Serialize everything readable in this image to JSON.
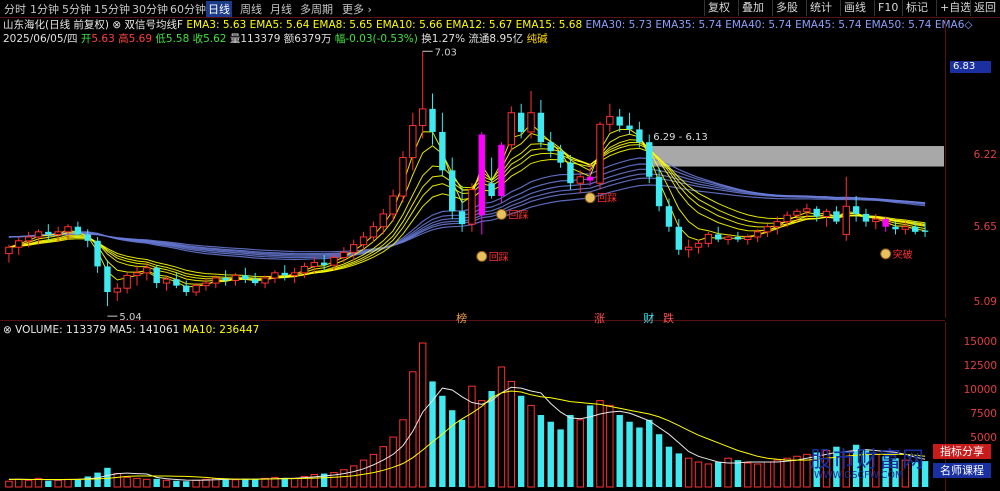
{
  "toolbar": {
    "timeframes": [
      "分时",
      "1分钟",
      "5分钟",
      "15分钟",
      "30分钟",
      "60分钟",
      "日线",
      "周线",
      "月线",
      "多周期",
      "更多"
    ],
    "active_timeframe": "日线",
    "right_buttons": [
      "复权",
      "叠加",
      "多股",
      "统计",
      "画线",
      "F10",
      "标记",
      "+自选",
      "返回"
    ]
  },
  "stock": {
    "name": "山东海化(日线 前复权)",
    "indicator": "双信号均线F"
  },
  "ema_values": {
    "EMA3": "5.63",
    "EMA5": "5.64",
    "EMA8": "5.65",
    "EMA10": "5.66",
    "EMA12": "5.67",
    "EMA15": "5.68",
    "EMA30": "5.73",
    "EMA35": "5.74",
    "EMA40": "5.74",
    "EMA45": "5.74",
    "EMA50": "5.74",
    "EMA6_truncated": "EMA6◇"
  },
  "quote": {
    "date": "2025/06/05/四",
    "open_label": "开",
    "open": "5.63",
    "high_label": "高",
    "high": "5.69",
    "low_label": "低",
    "low": "5.58",
    "close_label": "收",
    "close": "5.62",
    "volume_label": "量",
    "volume": "113379",
    "amount_label": "额",
    "amount": "6379万",
    "change_label": "幅",
    "change": "-0.03(-0.53%)",
    "turnover_label": "换",
    "turnover": "1.27%",
    "float_label": "流通",
    "float_cap": "8.95亿",
    "tag": "纯碱"
  },
  "volume_info": {
    "volume_label": "VOLUME:",
    "volume": "113379",
    "ma5_label": "MA5:",
    "ma5": "141061",
    "ma10_label": "MA10:",
    "ma10": "236447"
  },
  "price_axis": {
    "ticks": [
      "6.22",
      "5.65",
      "5.09"
    ],
    "current": "6.83"
  },
  "volume_axis": {
    "ticks": [
      "15000",
      "12500",
      "10000",
      "7500",
      "5000"
    ]
  },
  "annotations": {
    "high_mark": "7.03",
    "low_mark": "5.04",
    "zone_label": "6.29 - 6.13",
    "signal_1": "回踩",
    "signal_2": "回踩",
    "signal_3": "回踩",
    "signal_4": "突破",
    "event_bang": "榜",
    "event_zhang": "涨",
    "event_cai": "财",
    "event_die": "跌"
  },
  "watermark": {
    "main": "股市财富网",
    "url": "WWW.GSCFW.COM",
    "box1": "指标分享",
    "box2": "名师课程"
  },
  "colors": {
    "up": "#ff3030",
    "down": "#40e8f0",
    "magenta": "#ff00ff",
    "ema_yellow": "#ffff00",
    "ema_blue": "#6a7bd8",
    "zone": "#a8a8a8",
    "accent_blue": "#1a2fa0"
  },
  "chart_data": {
    "type": "candlestick",
    "price_range": [
      5.0,
      6.9
    ],
    "volume_range": [
      0,
      16000
    ],
    "price_ticks": [
      6.22,
      5.65,
      5.09
    ],
    "volume_ticks": [
      15000,
      12500,
      10000,
      7500,
      5000
    ],
    "zone": [
      6.13,
      6.29
    ],
    "candles": [
      {
        "o": 5.45,
        "h": 5.52,
        "l": 5.38,
        "c": 5.5
      },
      {
        "o": 5.5,
        "h": 5.58,
        "l": 5.44,
        "c": 5.55
      },
      {
        "o": 5.55,
        "h": 5.62,
        "l": 5.5,
        "c": 5.58
      },
      {
        "o": 5.58,
        "h": 5.64,
        "l": 5.52,
        "c": 5.62
      },
      {
        "o": 5.62,
        "h": 5.68,
        "l": 5.55,
        "c": 5.6
      },
      {
        "o": 5.6,
        "h": 5.66,
        "l": 5.54,
        "c": 5.62
      },
      {
        "o": 5.62,
        "h": 5.68,
        "l": 5.56,
        "c": 5.66
      },
      {
        "o": 5.66,
        "h": 5.7,
        "l": 5.58,
        "c": 5.6
      },
      {
        "o": 5.6,
        "h": 5.64,
        "l": 5.5,
        "c": 5.55
      },
      {
        "o": 5.55,
        "h": 5.58,
        "l": 5.3,
        "c": 5.35
      },
      {
        "o": 5.35,
        "h": 5.4,
        "l": 5.04,
        "c": 5.15
      },
      {
        "o": 5.15,
        "h": 5.22,
        "l": 5.08,
        "c": 5.18
      },
      {
        "o": 5.18,
        "h": 5.3,
        "l": 5.14,
        "c": 5.28
      },
      {
        "o": 5.28,
        "h": 5.36,
        "l": 5.2,
        "c": 5.3
      },
      {
        "o": 5.3,
        "h": 5.38,
        "l": 5.24,
        "c": 5.34
      },
      {
        "o": 5.34,
        "h": 5.36,
        "l": 5.18,
        "c": 5.22
      },
      {
        "o": 5.22,
        "h": 5.28,
        "l": 5.16,
        "c": 5.25
      },
      {
        "o": 5.25,
        "h": 5.3,
        "l": 5.18,
        "c": 5.2
      },
      {
        "o": 5.2,
        "h": 5.24,
        "l": 5.12,
        "c": 5.15
      },
      {
        "o": 5.15,
        "h": 5.22,
        "l": 5.12,
        "c": 5.2
      },
      {
        "o": 5.2,
        "h": 5.26,
        "l": 5.16,
        "c": 5.22
      },
      {
        "o": 5.22,
        "h": 5.28,
        "l": 5.18,
        "c": 5.26
      },
      {
        "o": 5.26,
        "h": 5.32,
        "l": 5.2,
        "c": 5.24
      },
      {
        "o": 5.24,
        "h": 5.3,
        "l": 5.2,
        "c": 5.28
      },
      {
        "o": 5.28,
        "h": 5.34,
        "l": 5.22,
        "c": 5.25
      },
      {
        "o": 5.25,
        "h": 5.3,
        "l": 5.2,
        "c": 5.22
      },
      {
        "o": 5.22,
        "h": 5.28,
        "l": 5.18,
        "c": 5.26
      },
      {
        "o": 5.26,
        "h": 5.32,
        "l": 5.22,
        "c": 5.3
      },
      {
        "o": 5.3,
        "h": 5.36,
        "l": 5.24,
        "c": 5.28
      },
      {
        "o": 5.28,
        "h": 5.34,
        "l": 5.22,
        "c": 5.3
      },
      {
        "o": 5.3,
        "h": 5.38,
        "l": 5.26,
        "c": 5.35
      },
      {
        "o": 5.35,
        "h": 5.42,
        "l": 5.3,
        "c": 5.38
      },
      {
        "o": 5.38,
        "h": 5.44,
        "l": 5.32,
        "c": 5.36
      },
      {
        "o": 5.36,
        "h": 5.45,
        "l": 5.32,
        "c": 5.42
      },
      {
        "o": 5.42,
        "h": 5.5,
        "l": 5.38,
        "c": 5.46
      },
      {
        "o": 5.46,
        "h": 5.56,
        "l": 5.4,
        "c": 5.52
      },
      {
        "o": 5.52,
        "h": 5.62,
        "l": 5.48,
        "c": 5.58
      },
      {
        "o": 5.58,
        "h": 5.7,
        "l": 5.54,
        "c": 5.66
      },
      {
        "o": 5.66,
        "h": 5.8,
        "l": 5.6,
        "c": 5.76
      },
      {
        "o": 5.76,
        "h": 5.95,
        "l": 5.7,
        "c": 5.9
      },
      {
        "o": 5.9,
        "h": 6.25,
        "l": 5.85,
        "c": 6.2
      },
      {
        "o": 6.2,
        "h": 6.55,
        "l": 6.1,
        "c": 6.45
      },
      {
        "o": 6.45,
        "h": 7.03,
        "l": 6.35,
        "c": 6.58
      },
      {
        "o": 6.58,
        "h": 6.7,
        "l": 6.3,
        "c": 6.4
      },
      {
        "o": 6.4,
        "h": 6.55,
        "l": 6.05,
        "c": 6.1
      },
      {
        "o": 6.1,
        "h": 6.2,
        "l": 5.72,
        "c": 5.78
      },
      {
        "o": 5.78,
        "h": 5.98,
        "l": 5.62,
        "c": 5.68
      },
      {
        "o": 5.68,
        "h": 6.0,
        "l": 5.62,
        "c": 5.95
      },
      {
        "o": 5.75,
        "h": 6.4,
        "l": 5.6,
        "c": 6.38
      },
      {
        "o": 6.0,
        "h": 6.2,
        "l": 5.88,
        "c": 5.9
      },
      {
        "o": 5.9,
        "h": 6.32,
        "l": 5.85,
        "c": 6.3
      },
      {
        "o": 6.3,
        "h": 6.6,
        "l": 6.25,
        "c": 6.55
      },
      {
        "o": 6.55,
        "h": 6.62,
        "l": 6.35,
        "c": 6.4
      },
      {
        "o": 6.4,
        "h": 6.72,
        "l": 6.35,
        "c": 6.55
      },
      {
        "o": 6.55,
        "h": 6.65,
        "l": 6.28,
        "c": 6.32
      },
      {
        "o": 6.32,
        "h": 6.4,
        "l": 6.2,
        "c": 6.25
      },
      {
        "o": 6.25,
        "h": 6.3,
        "l": 6.12,
        "c": 6.16
      },
      {
        "o": 6.16,
        "h": 6.22,
        "l": 5.95,
        "c": 6.0
      },
      {
        "o": 6.0,
        "h": 6.1,
        "l": 5.92,
        "c": 6.05
      },
      {
        "o": 6.05,
        "h": 6.15,
        "l": 5.98,
        "c": 6.02
      },
      {
        "o": 6.0,
        "h": 6.48,
        "l": 5.95,
        "c": 6.46
      },
      {
        "o": 6.46,
        "h": 6.62,
        "l": 6.4,
        "c": 6.52
      },
      {
        "o": 6.52,
        "h": 6.58,
        "l": 6.4,
        "c": 6.45
      },
      {
        "o": 6.45,
        "h": 6.55,
        "l": 6.38,
        "c": 6.42
      },
      {
        "o": 6.42,
        "h": 6.48,
        "l": 6.28,
        "c": 6.32
      },
      {
        "o": 6.32,
        "h": 6.38,
        "l": 6.0,
        "c": 6.05
      },
      {
        "o": 6.05,
        "h": 6.12,
        "l": 5.78,
        "c": 5.82
      },
      {
        "o": 5.82,
        "h": 5.88,
        "l": 5.62,
        "c": 5.66
      },
      {
        "o": 5.66,
        "h": 5.72,
        "l": 5.44,
        "c": 5.48
      },
      {
        "o": 5.48,
        "h": 5.56,
        "l": 5.42,
        "c": 5.5
      },
      {
        "o": 5.5,
        "h": 5.56,
        "l": 5.45,
        "c": 5.53
      },
      {
        "o": 5.53,
        "h": 5.62,
        "l": 5.5,
        "c": 5.6
      },
      {
        "o": 5.6,
        "h": 5.66,
        "l": 5.54,
        "c": 5.56
      },
      {
        "o": 5.56,
        "h": 5.6,
        "l": 5.52,
        "c": 5.58
      },
      {
        "o": 5.58,
        "h": 5.62,
        "l": 5.54,
        "c": 5.56
      },
      {
        "o": 5.56,
        "h": 5.6,
        "l": 5.52,
        "c": 5.58
      },
      {
        "o": 5.58,
        "h": 5.64,
        "l": 5.54,
        "c": 5.62
      },
      {
        "o": 5.62,
        "h": 5.68,
        "l": 5.58,
        "c": 5.66
      },
      {
        "o": 5.66,
        "h": 5.74,
        "l": 5.6,
        "c": 5.7
      },
      {
        "o": 5.7,
        "h": 5.78,
        "l": 5.66,
        "c": 5.75
      },
      {
        "o": 5.75,
        "h": 5.8,
        "l": 5.7,
        "c": 5.78
      },
      {
        "o": 5.78,
        "h": 5.84,
        "l": 5.72,
        "c": 5.8
      },
      {
        "o": 5.8,
        "h": 5.82,
        "l": 5.7,
        "c": 5.74
      },
      {
        "o": 5.74,
        "h": 5.8,
        "l": 5.66,
        "c": 5.78
      },
      {
        "o": 5.78,
        "h": 5.82,
        "l": 5.68,
        "c": 5.7
      },
      {
        "o": 5.6,
        "h": 6.05,
        "l": 5.55,
        "c": 5.82
      },
      {
        "o": 5.82,
        "h": 5.9,
        "l": 5.7,
        "c": 5.76
      },
      {
        "o": 5.76,
        "h": 5.8,
        "l": 5.66,
        "c": 5.7
      },
      {
        "o": 5.7,
        "h": 5.76,
        "l": 5.64,
        "c": 5.72
      },
      {
        "o": 5.72,
        "h": 5.74,
        "l": 5.62,
        "c": 5.66
      },
      {
        "o": 5.66,
        "h": 5.7,
        "l": 5.6,
        "c": 5.64
      },
      {
        "o": 5.64,
        "h": 5.7,
        "l": 5.6,
        "c": 5.66
      },
      {
        "o": 5.66,
        "h": 5.7,
        "l": 5.6,
        "c": 5.62
      },
      {
        "o": 5.63,
        "h": 5.69,
        "l": 5.58,
        "c": 5.62
      }
    ],
    "volumes": [
      600,
      800,
      700,
      900,
      650,
      700,
      800,
      750,
      1100,
      1500,
      2000,
      1400,
      1000,
      900,
      800,
      850,
      700,
      650,
      600,
      700,
      800,
      900,
      800,
      750,
      850,
      800,
      900,
      1000,
      950,
      900,
      1100,
      1300,
      1400,
      1500,
      1800,
      2200,
      2800,
      3400,
      4200,
      5200,
      7000,
      12000,
      15000,
      11000,
      9500,
      8000,
      7000,
      10500,
      9000,
      10000,
      12500,
      11000,
      9500,
      8500,
      7500,
      6800,
      6000,
      7500,
      7000,
      8500,
      9000,
      8500,
      7500,
      6800,
      6200,
      7000,
      5500,
      4200,
      3500,
      3000,
      2600,
      2400,
      2600,
      3000,
      2800,
      2500,
      2400,
      2600,
      2800,
      3000,
      3200,
      3400,
      3600,
      3800,
      4200,
      3600,
      4400,
      3800,
      3400,
      3200,
      3000,
      2800,
      2600,
      2700,
      2500
    ],
    "ma5": [
      800,
      800,
      780,
      780,
      770,
      760,
      780,
      800,
      850,
      950,
      1200,
      1400,
      1450,
      1400,
      1350,
      1000,
      850,
      780,
      720,
      700,
      720,
      760,
      790,
      800,
      820,
      820,
      840,
      860,
      900,
      920,
      980,
      1050,
      1150,
      1250,
      1400,
      1600,
      1900,
      2300,
      2800,
      3400,
      4300,
      5800,
      7800,
      9000,
      10300,
      10100,
      9400,
      8800,
      8600,
      9000,
      9800,
      10400,
      10300,
      10000,
      9800,
      8700,
      7800,
      7200,
      7100,
      7300,
      7600,
      7800,
      7900,
      7700,
      7300,
      6900,
      6200,
      5500,
      4600,
      3700,
      3200,
      2900,
      2600,
      2500,
      2500,
      2600,
      2600,
      2600,
      2600,
      2700,
      2800,
      3000,
      3200,
      3400,
      3600,
      3700,
      3800,
      3900,
      3800,
      3700,
      3600,
      3400,
      3100,
      2900,
      2800
    ],
    "ma10": [
      780,
      790,
      790,
      780,
      780,
      780,
      780,
      790,
      810,
      840,
      900,
      1000,
      1100,
      1150,
      1150,
      1150,
      1150,
      1130,
      1100,
      1050,
      1000,
      900,
      850,
      820,
      800,
      810,
      820,
      840,
      860,
      880,
      900,
      930,
      960,
      1010,
      1080,
      1180,
      1320,
      1500,
      1740,
      2050,
      2450,
      3050,
      3850,
      4700,
      5500,
      6400,
      7100,
      7700,
      8400,
      9300,
      9800,
      10000,
      9900,
      9600,
      9400,
      9300,
      9100,
      8900,
      8800,
      8700,
      8600,
      8400,
      8200,
      8000,
      7800,
      7600,
      7300,
      6900,
      6400,
      5900,
      5400,
      5000,
      4600,
      4200,
      3800,
      3500,
      3200,
      3000,
      2900,
      2800,
      2800,
      2800,
      2900,
      3000,
      3100,
      3200,
      3300,
      3400,
      3400,
      3400,
      3400,
      3400,
      3300,
      3200,
      3100
    ],
    "signals": [
      {
        "index": 48,
        "text_key": "signal_1"
      },
      {
        "index": 50,
        "text_key": "signal_2"
      },
      {
        "index": 59,
        "text_key": "signal_3"
      },
      {
        "index": 89,
        "text_key": "signal_4"
      }
    ],
    "magenta_candles": [
      48,
      50,
      59,
      89
    ],
    "events": [
      {
        "index": 46,
        "key": "event_bang"
      },
      {
        "index": 60,
        "key": "event_zhang"
      },
      {
        "index": 65,
        "key": "event_cai"
      },
      {
        "index": 67,
        "key": "event_die"
      }
    ]
  }
}
